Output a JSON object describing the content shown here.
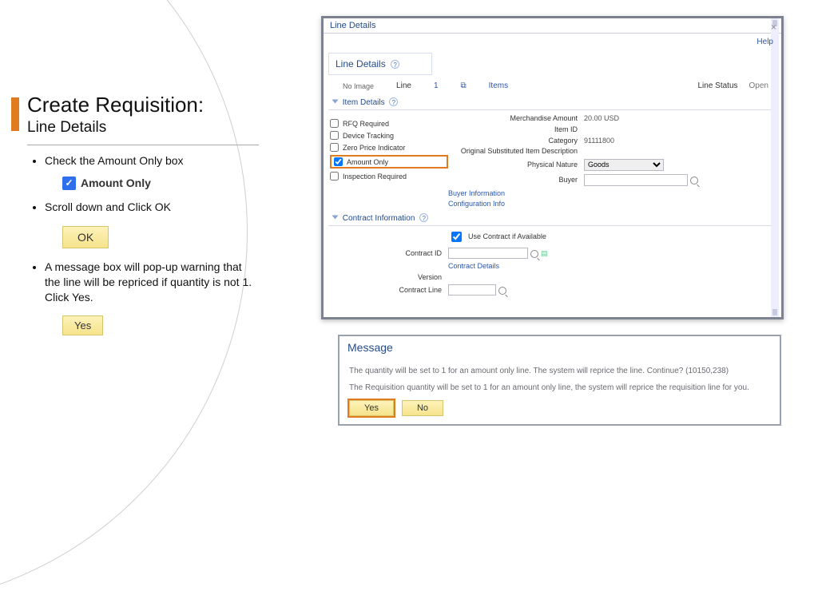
{
  "slide": {
    "title": "Create Requisition:",
    "subtitle": "Line Details",
    "bullet1": "Check the Amount Only box",
    "amount_only_label": "Amount Only",
    "bullet2": "Scroll down and Click OK",
    "ok_label": "OK",
    "bullet3": "A message box will pop-up warning that the line will be repriced if quantity is not 1. Click Yes.",
    "yes_label": "Yes"
  },
  "window": {
    "title": "Line Details",
    "help": "Help",
    "header": "Line Details",
    "no_image": "No Image",
    "line_label": "Line",
    "line_value": "1",
    "items_link": "Items",
    "line_status_label": "Line Status",
    "line_status_value": "Open",
    "section_item": "Item Details",
    "merch_label": "Merchandise Amount",
    "merch_value": "20.00 USD",
    "item_id_label": "Item ID",
    "category_label": "Category",
    "category_value": "91111800",
    "orig_sub_label": "Original Substituted Item Description",
    "phys_label": "Physical Nature",
    "phys_value": "Goods",
    "buyer_label": "Buyer",
    "buyer_info": "Buyer Information",
    "config_info": "Configuration Info",
    "rfq": "RFQ Required",
    "device": "Device Tracking",
    "zero": "Zero Price Indicator",
    "amount_only": "Amount Only",
    "inspection": "Inspection Required",
    "section_contract": "Contract Information",
    "use_contract": "Use Contract if Available",
    "contract_id": "Contract ID",
    "contract_details": "Contract Details",
    "version": "Version",
    "contract_line": "Contract Line"
  },
  "message": {
    "title": "Message",
    "line1": "The quantity will be set to 1 for an amount only line.  The system will reprice the line.  Continue? (10150,238)",
    "line2": "The Requisition quantity will be set to 1 for an amount only line, the system will reprice the requisition line for you.",
    "yes": "Yes",
    "no": "No"
  }
}
